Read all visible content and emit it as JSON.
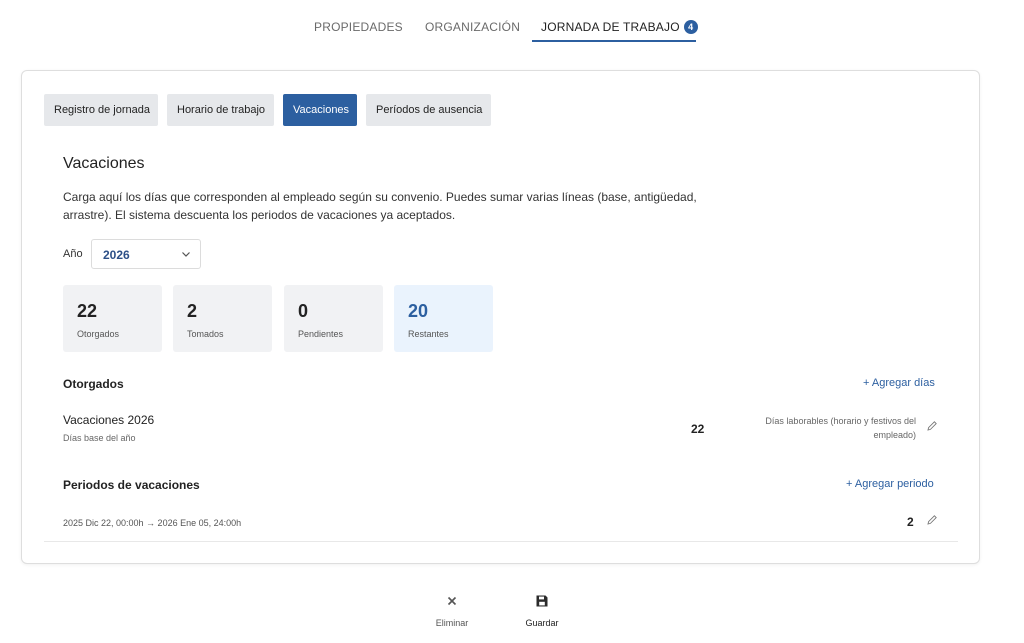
{
  "top_tabs": {
    "properties": "PROPIEDADES",
    "organization": "ORGANIZACIÓN",
    "workday": "JORNADA DE TRABAJO",
    "workday_badge": "4"
  },
  "subtabs": {
    "registro": "Registro de jornada",
    "horario": "Horario de trabajo",
    "vacaciones": "Vacaciones",
    "periodos": "Períodos de ausencia",
    "active": "Vacaciones"
  },
  "section": {
    "title": "Vacaciones",
    "description": "Carga aquí los días que corresponden al empleado según su convenio. Puedes sumar varias líneas (base, antigüedad, arrastre). El sistema descuenta los periodos de vacaciones ya aceptados."
  },
  "year": {
    "label": "Año",
    "value": "2026"
  },
  "stats": [
    {
      "value": "22",
      "label": "Otorgados"
    },
    {
      "value": "2",
      "label": "Tomados"
    },
    {
      "value": "0",
      "label": "Pendientes"
    },
    {
      "value": "20",
      "label": "Restantes"
    }
  ],
  "granted": {
    "title": "Otorgados",
    "add_label": "+ Agregar días",
    "items": [
      {
        "title": "Vacaciones 2026",
        "subtitle": "Días base del año",
        "days": "22",
        "note": "Días laborables (horario y festivos del empleado)"
      }
    ]
  },
  "periods": {
    "title": "Periodos de vacaciones",
    "add_label": "+ Agregar periodo",
    "items": [
      {
        "range": "2025 Dic 22, 00:00h → 2026 Ene 05, 24:00h",
        "days": "2"
      }
    ]
  },
  "actions": {
    "delete_label": "Eliminar",
    "save_label": "Guardar"
  },
  "colors": {
    "accent": "#2c5fa0",
    "stat_bg": "#f1f2f4",
    "stat_highlight_bg": "#eaf3fd"
  }
}
